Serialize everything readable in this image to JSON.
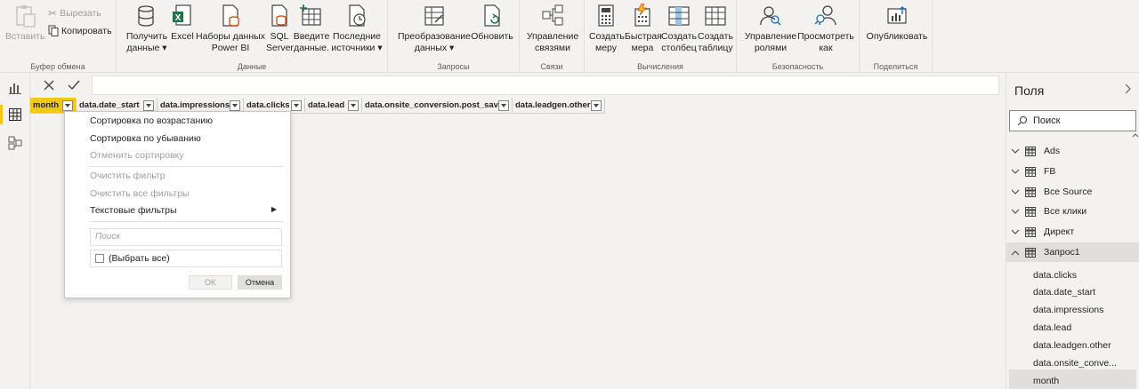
{
  "ribbon": {
    "clipboard": {
      "label": "Буфер обмена",
      "paste": "Вставить",
      "cut": "Вырезать",
      "copy": "Копировать"
    },
    "data": {
      "label": "Данные",
      "get_data_1": "Получить",
      "get_data_2": "данные",
      "excel": "Excel",
      "datasets_1": "Наборы данных",
      "datasets_2": "Power BI",
      "sql_1": "SQL",
      "sql_2": "Server",
      "enter_1": "Введите",
      "enter_2": "данные.",
      "recent_1": "Последние",
      "recent_2": "источники"
    },
    "queries": {
      "label": "Запросы",
      "transform_1": "Преобразование",
      "transform_2": "данных",
      "refresh": "Обновить"
    },
    "relationships": {
      "label": "Связи",
      "manage_1": "Управление",
      "manage_2": "связями"
    },
    "calculations": {
      "label": "Вычисления",
      "measure_1": "Создать",
      "measure_2": "меру",
      "quick_1": "Быстрая",
      "quick_2": "мера",
      "column_1": "Создать",
      "column_2": "столбец",
      "table_1": "Создать",
      "table_2": "таблицу"
    },
    "security": {
      "label": "Безопасность",
      "roles_1": "Управление",
      "roles_2": "ролями",
      "viewas_1": "Просмотреть",
      "viewas_2": "как"
    },
    "share": {
      "label": "Поделиться",
      "publish": "Опубликовать"
    }
  },
  "grid": {
    "columns": [
      "month",
      "data.date_start",
      "data.impressions",
      "data.clicks",
      "data.lead",
      "data.onsite_conversion.post_save",
      "data.leadgen.other"
    ]
  },
  "menu": {
    "sort_asc": "Сортировка по возрастанию",
    "sort_desc": "Сортировка по убыванию",
    "clear_sort": "Отменить сортировку",
    "clear_filter": "Очистить фильтр",
    "clear_all_filters": "Очистить все фильтры",
    "text_filters": "Текстовые фильтры",
    "search_placeholder": "Поиск",
    "select_all": "(Выбрать все)",
    "ok": "OK",
    "cancel": "Отмена"
  },
  "fields": {
    "title": "Поля",
    "search": "Поиск",
    "tables": [
      "Ads",
      "FB",
      "Все Source",
      "Все клики",
      "Директ",
      "Запрос1"
    ],
    "active_table": "Запрос1",
    "items": [
      "data.clicks",
      "data.date_start",
      "data.impressions",
      "data.lead",
      "data.leadgen.other",
      "data.onsite_conve...",
      "month"
    ]
  },
  "colors": {
    "accent": "#f2c811",
    "background": "#f3f2f1",
    "excel_green": "#217346"
  }
}
